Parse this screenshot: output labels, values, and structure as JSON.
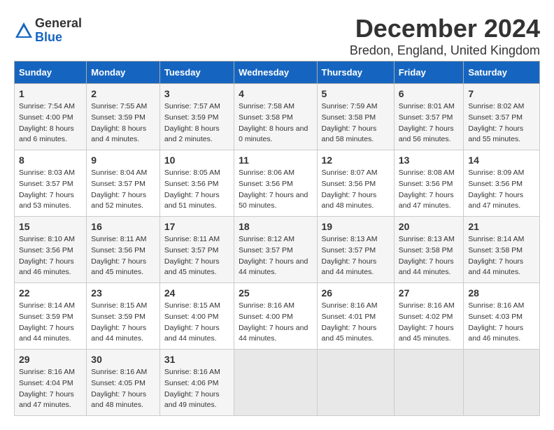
{
  "logo": {
    "general": "General",
    "blue": "Blue"
  },
  "title": "December 2024",
  "subtitle": "Bredon, England, United Kingdom",
  "header_days": [
    "Sunday",
    "Monday",
    "Tuesday",
    "Wednesday",
    "Thursday",
    "Friday",
    "Saturday"
  ],
  "weeks": [
    [
      {
        "day": "1",
        "rise": "Sunrise: 7:54 AM",
        "set": "Sunset: 4:00 PM",
        "daylight": "Daylight: 8 hours and 6 minutes."
      },
      {
        "day": "2",
        "rise": "Sunrise: 7:55 AM",
        "set": "Sunset: 3:59 PM",
        "daylight": "Daylight: 8 hours and 4 minutes."
      },
      {
        "day": "3",
        "rise": "Sunrise: 7:57 AM",
        "set": "Sunset: 3:59 PM",
        "daylight": "Daylight: 8 hours and 2 minutes."
      },
      {
        "day": "4",
        "rise": "Sunrise: 7:58 AM",
        "set": "Sunset: 3:58 PM",
        "daylight": "Daylight: 8 hours and 0 minutes."
      },
      {
        "day": "5",
        "rise": "Sunrise: 7:59 AM",
        "set": "Sunset: 3:58 PM",
        "daylight": "Daylight: 7 hours and 58 minutes."
      },
      {
        "day": "6",
        "rise": "Sunrise: 8:01 AM",
        "set": "Sunset: 3:57 PM",
        "daylight": "Daylight: 7 hours and 56 minutes."
      },
      {
        "day": "7",
        "rise": "Sunrise: 8:02 AM",
        "set": "Sunset: 3:57 PM",
        "daylight": "Daylight: 7 hours and 55 minutes."
      }
    ],
    [
      {
        "day": "8",
        "rise": "Sunrise: 8:03 AM",
        "set": "Sunset: 3:57 PM",
        "daylight": "Daylight: 7 hours and 53 minutes."
      },
      {
        "day": "9",
        "rise": "Sunrise: 8:04 AM",
        "set": "Sunset: 3:57 PM",
        "daylight": "Daylight: 7 hours and 52 minutes."
      },
      {
        "day": "10",
        "rise": "Sunrise: 8:05 AM",
        "set": "Sunset: 3:56 PM",
        "daylight": "Daylight: 7 hours and 51 minutes."
      },
      {
        "day": "11",
        "rise": "Sunrise: 8:06 AM",
        "set": "Sunset: 3:56 PM",
        "daylight": "Daylight: 7 hours and 50 minutes."
      },
      {
        "day": "12",
        "rise": "Sunrise: 8:07 AM",
        "set": "Sunset: 3:56 PM",
        "daylight": "Daylight: 7 hours and 48 minutes."
      },
      {
        "day": "13",
        "rise": "Sunrise: 8:08 AM",
        "set": "Sunset: 3:56 PM",
        "daylight": "Daylight: 7 hours and 47 minutes."
      },
      {
        "day": "14",
        "rise": "Sunrise: 8:09 AM",
        "set": "Sunset: 3:56 PM",
        "daylight": "Daylight: 7 hours and 47 minutes."
      }
    ],
    [
      {
        "day": "15",
        "rise": "Sunrise: 8:10 AM",
        "set": "Sunset: 3:56 PM",
        "daylight": "Daylight: 7 hours and 46 minutes."
      },
      {
        "day": "16",
        "rise": "Sunrise: 8:11 AM",
        "set": "Sunset: 3:56 PM",
        "daylight": "Daylight: 7 hours and 45 minutes."
      },
      {
        "day": "17",
        "rise": "Sunrise: 8:11 AM",
        "set": "Sunset: 3:57 PM",
        "daylight": "Daylight: 7 hours and 45 minutes."
      },
      {
        "day": "18",
        "rise": "Sunrise: 8:12 AM",
        "set": "Sunset: 3:57 PM",
        "daylight": "Daylight: 7 hours and 44 minutes."
      },
      {
        "day": "19",
        "rise": "Sunrise: 8:13 AM",
        "set": "Sunset: 3:57 PM",
        "daylight": "Daylight: 7 hours and 44 minutes."
      },
      {
        "day": "20",
        "rise": "Sunrise: 8:13 AM",
        "set": "Sunset: 3:58 PM",
        "daylight": "Daylight: 7 hours and 44 minutes."
      },
      {
        "day": "21",
        "rise": "Sunrise: 8:14 AM",
        "set": "Sunset: 3:58 PM",
        "daylight": "Daylight: 7 hours and 44 minutes."
      }
    ],
    [
      {
        "day": "22",
        "rise": "Sunrise: 8:14 AM",
        "set": "Sunset: 3:59 PM",
        "daylight": "Daylight: 7 hours and 44 minutes."
      },
      {
        "day": "23",
        "rise": "Sunrise: 8:15 AM",
        "set": "Sunset: 3:59 PM",
        "daylight": "Daylight: 7 hours and 44 minutes."
      },
      {
        "day": "24",
        "rise": "Sunrise: 8:15 AM",
        "set": "Sunset: 4:00 PM",
        "daylight": "Daylight: 7 hours and 44 minutes."
      },
      {
        "day": "25",
        "rise": "Sunrise: 8:16 AM",
        "set": "Sunset: 4:00 PM",
        "daylight": "Daylight: 7 hours and 44 minutes."
      },
      {
        "day": "26",
        "rise": "Sunrise: 8:16 AM",
        "set": "Sunset: 4:01 PM",
        "daylight": "Daylight: 7 hours and 45 minutes."
      },
      {
        "day": "27",
        "rise": "Sunrise: 8:16 AM",
        "set": "Sunset: 4:02 PM",
        "daylight": "Daylight: 7 hours and 45 minutes."
      },
      {
        "day": "28",
        "rise": "Sunrise: 8:16 AM",
        "set": "Sunset: 4:03 PM",
        "daylight": "Daylight: 7 hours and 46 minutes."
      }
    ],
    [
      {
        "day": "29",
        "rise": "Sunrise: 8:16 AM",
        "set": "Sunset: 4:04 PM",
        "daylight": "Daylight: 7 hours and 47 minutes."
      },
      {
        "day": "30",
        "rise": "Sunrise: 8:16 AM",
        "set": "Sunset: 4:05 PM",
        "daylight": "Daylight: 7 hours and 48 minutes."
      },
      {
        "day": "31",
        "rise": "Sunrise: 8:16 AM",
        "set": "Sunset: 4:06 PM",
        "daylight": "Daylight: 7 hours and 49 minutes."
      },
      null,
      null,
      null,
      null
    ]
  ]
}
